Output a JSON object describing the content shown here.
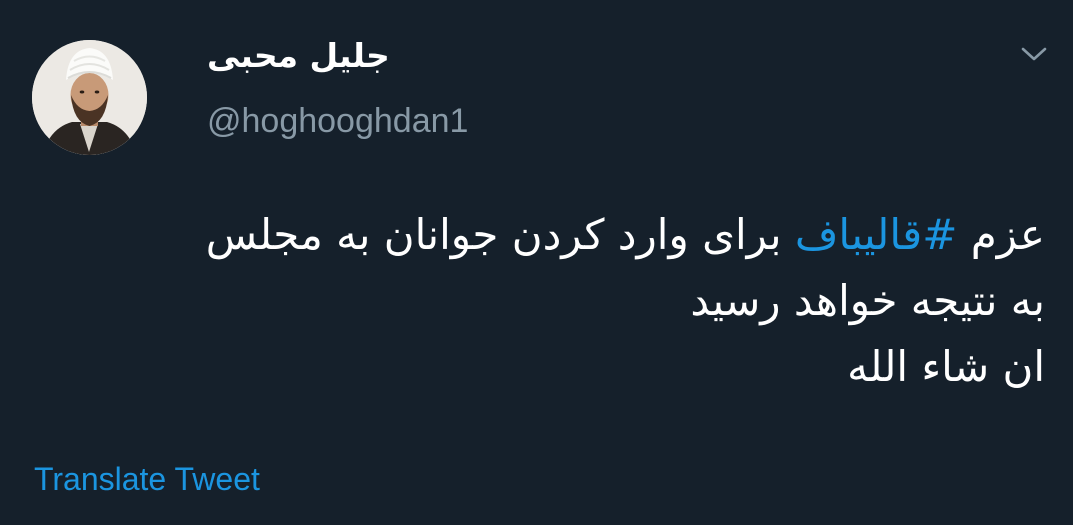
{
  "tweet": {
    "author": {
      "display_name": "جلیل محبی",
      "handle": "@hoghooghdan1",
      "avatar_icon": "avatar-photo"
    },
    "menu_icon": "chevron-down-icon",
    "text": {
      "line1_prefix": "عزم ",
      "hashtag": "#قالیباف",
      "line1_suffix": " برای وارد کردن جوانان به مجلس",
      "line2": "به نتیجه خواهد رسید",
      "line3": "ان شاء الله"
    },
    "translate_label": "Translate Tweet"
  },
  "colors": {
    "background": "#15202b",
    "text_primary": "#ffffff",
    "text_secondary": "#8899a6",
    "link": "#1b95e0"
  }
}
